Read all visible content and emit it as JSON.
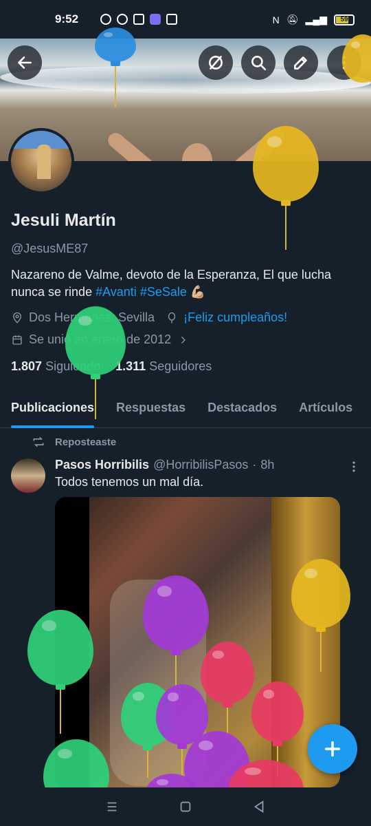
{
  "status_bar": {
    "time": "9:52",
    "battery": "59"
  },
  "header": {
    "back_icon": "arrow-left-icon",
    "actions": [
      "hide-icon",
      "search-icon",
      "compose-icon",
      "more-vertical-icon"
    ]
  },
  "profile": {
    "name": "Jesuli Martín",
    "handle": "@JesusME87",
    "bio_text": "Nazareno de Valme, devoto de la Esperanza, El que lucha nunca se rinde ",
    "bio_tag1": "#Avanti",
    "bio_tag2": "#SeSale",
    "bio_emoji": "💪🏼",
    "location": "Dos Hermanas, Sevilla",
    "birthday": "¡Feliz cumpleaños!",
    "joined": "Se unió en enero de 2012",
    "following_count": "1.807",
    "following_label": "Siguiendo",
    "followers_count": "1.311",
    "followers_label": "Seguidores"
  },
  "tabs": [
    "Publicaciones",
    "Respuestas",
    "Destacados",
    "Artículos"
  ],
  "post": {
    "repost_label": "Reposteaste",
    "author": "Pasos Horribilis",
    "author_handle": "@HorribilisPasos",
    "separator": "·",
    "time": "8h",
    "text": "Todos tenemos un mal día."
  },
  "colors": {
    "background": "#15202b",
    "accent": "#1d9bf0",
    "muted": "#8b98a5",
    "text": "#e7e9ea"
  }
}
